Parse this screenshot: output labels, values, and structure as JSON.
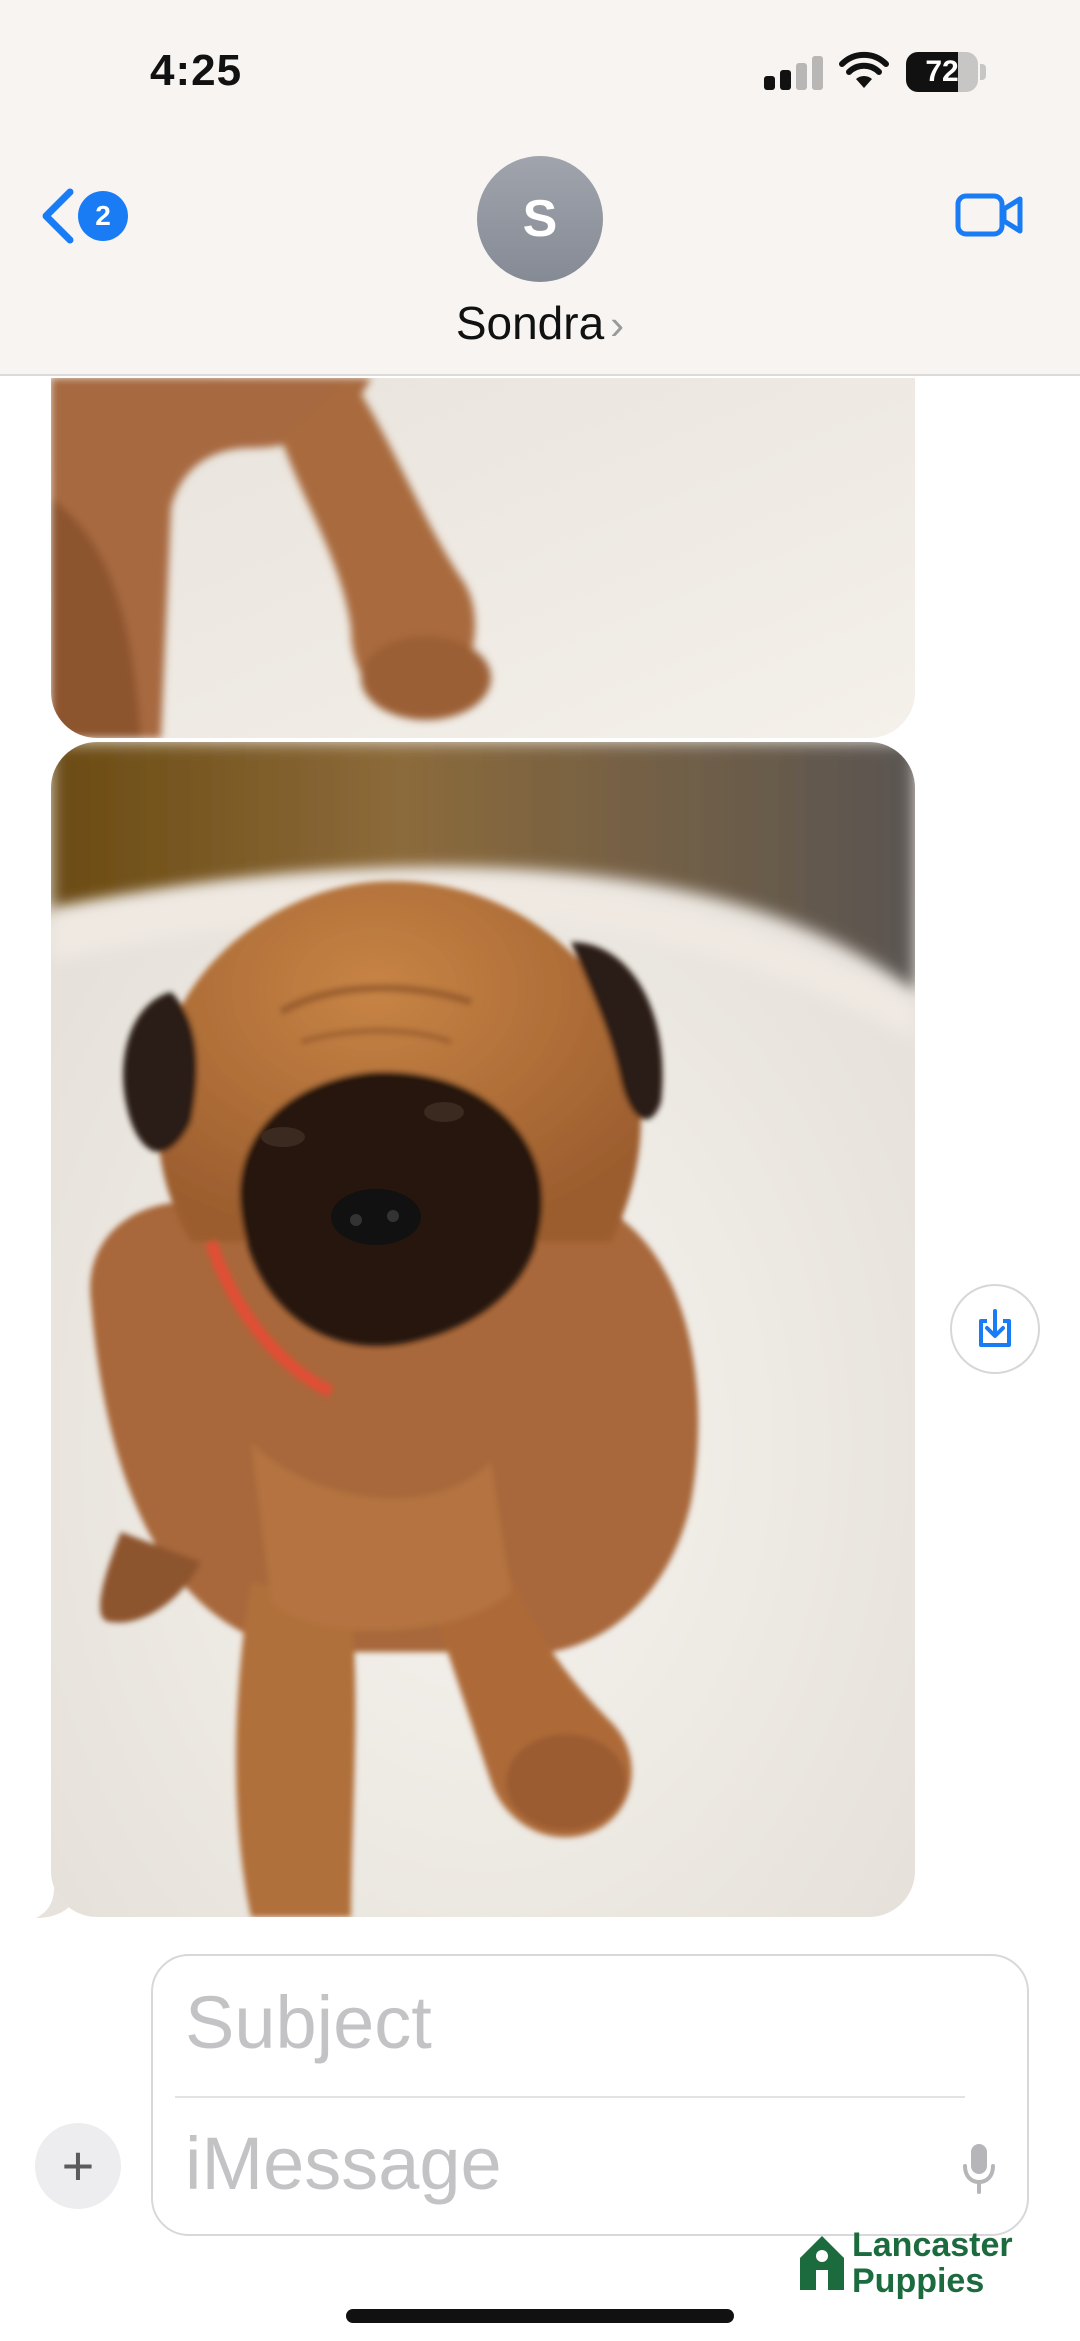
{
  "status_bar": {
    "time": "4:25",
    "battery_level": "72",
    "signal_bars_on": 2,
    "signal_bars_total": 4
  },
  "header": {
    "back_badge_count": "2",
    "avatar_initial": "S",
    "contact_name": "Sondra",
    "contact_chevron": "›",
    "accent_color": "#1a7cf5"
  },
  "conversation": {
    "photos": [
      {
        "subject": "puppy-legs-photo"
      },
      {
        "subject": "bullmastiff-puppy-photo"
      }
    ]
  },
  "composer": {
    "plus_label": "+",
    "subject_placeholder": "Subject",
    "message_placeholder": "iMessage"
  },
  "watermark": {
    "line1": "Lancaster",
    "line2": "Puppies",
    "color": "#1b6b3e"
  }
}
